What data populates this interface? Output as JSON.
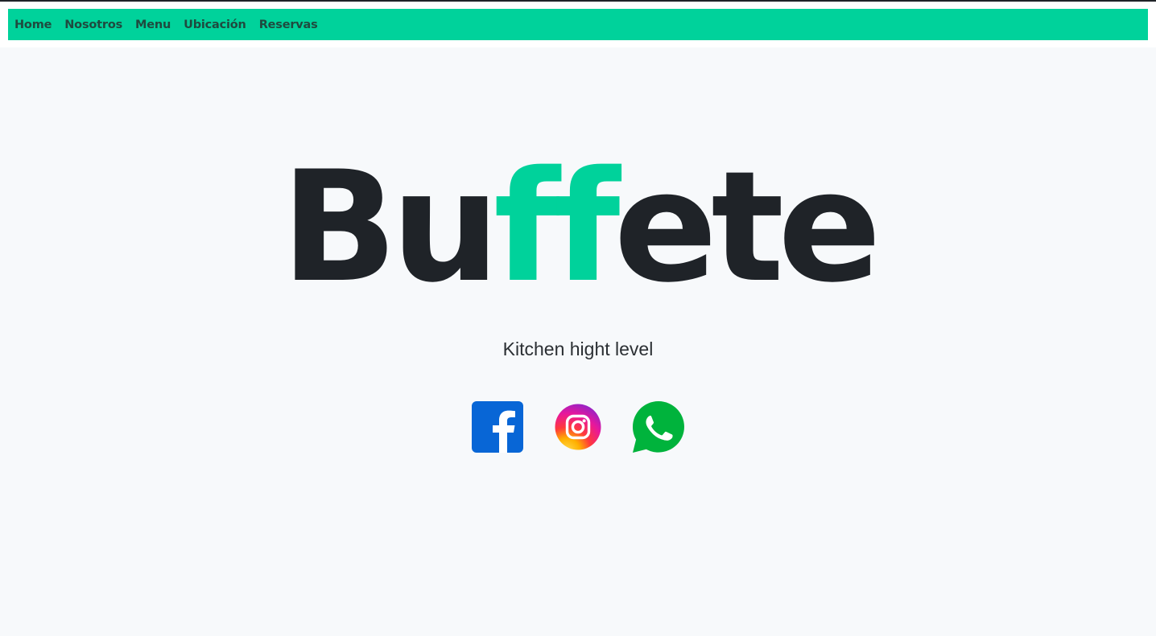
{
  "nav": {
    "items": [
      {
        "label": "Home"
      },
      {
        "label": "Nosotros"
      },
      {
        "label": "Menu"
      },
      {
        "label": "Ubicación"
      },
      {
        "label": "Reservas"
      }
    ]
  },
  "hero": {
    "title_part1": "Bu",
    "title_accent": "ff",
    "title_part2": "ete",
    "subtitle": "Kitchen hight level"
  },
  "social": [
    {
      "icon": "facebook-icon"
    },
    {
      "icon": "instagram-icon"
    },
    {
      "icon": "whatsapp-icon"
    }
  ],
  "colors": {
    "accent": "#00d29b",
    "text_dark": "#1f2328",
    "background": "#f7f9fb",
    "facebook": "#0866d6",
    "whatsapp": "#00b33c"
  }
}
